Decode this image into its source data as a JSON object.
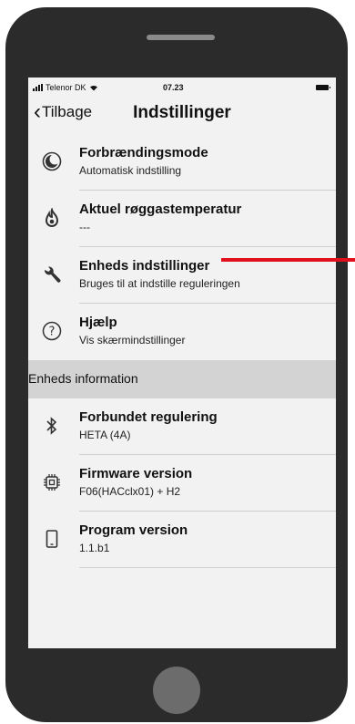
{
  "statusbar": {
    "carrier": "Telenor DK",
    "time": "07.23"
  },
  "nav": {
    "back_label": "Tilbage",
    "title": "Indstillinger"
  },
  "settings": [
    {
      "icon": "moon-icon",
      "title": "Forbrændingsmode",
      "subtitle": "Automatisk indstilling"
    },
    {
      "icon": "flame-icon",
      "title": "Aktuel røggastemperatur",
      "subtitle": "---"
    },
    {
      "icon": "wrench-icon",
      "title": "Enheds indstillinger",
      "subtitle": "Bruges til at indstille reguleringen"
    },
    {
      "icon": "help-icon",
      "title": "Hjælp",
      "subtitle": "Vis skærmindstillinger"
    }
  ],
  "section": {
    "label": "Enheds information"
  },
  "info": [
    {
      "icon": "bluetooth-icon",
      "title": "Forbundet regulering",
      "subtitle": "HETA (4A)"
    },
    {
      "icon": "chip-icon",
      "title": "Firmware version",
      "subtitle": "F06(HACclx01) + H2"
    },
    {
      "icon": "phone-icon",
      "title": "Program version",
      "subtitle": "1.1.b1"
    }
  ],
  "colors": {
    "annotation": "#e0101c",
    "phone_frame": "#2b2b2b",
    "section_bg": "#d3d3d3"
  }
}
